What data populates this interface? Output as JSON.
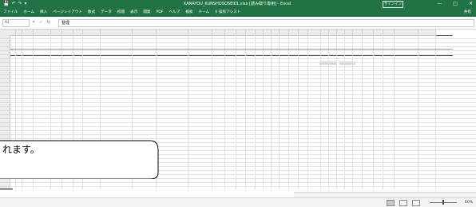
{
  "titlebar": {
    "quick_access": [
      "💾",
      "↶",
      "↷",
      "▾"
    ],
    "window_title": "KANRYOU_KUNSHOSOSEI01.xlsx [読み取り専用] - Excel",
    "sign_in_label": "サインイン",
    "window_buttons": [
      "—",
      "□",
      "✕"
    ]
  },
  "ribbon": {
    "tabs": [
      "ファイル",
      "ホーム",
      "挿入",
      "ページレイアウト",
      "数式",
      "データ",
      "校閲",
      "表示",
      "開発",
      "PDF",
      "ヘルプ",
      "検索",
      "チーム",
      "♀ 操作アシスト"
    ],
    "share_label": "共有"
  },
  "formula_bar": {
    "name_box": "A1",
    "cancel": "✕",
    "enter": "✓",
    "fx": "fx",
    "content": "整理"
  },
  "callout": {
    "text": "れます。"
  },
  "status": {
    "zoom": "60%"
  }
}
